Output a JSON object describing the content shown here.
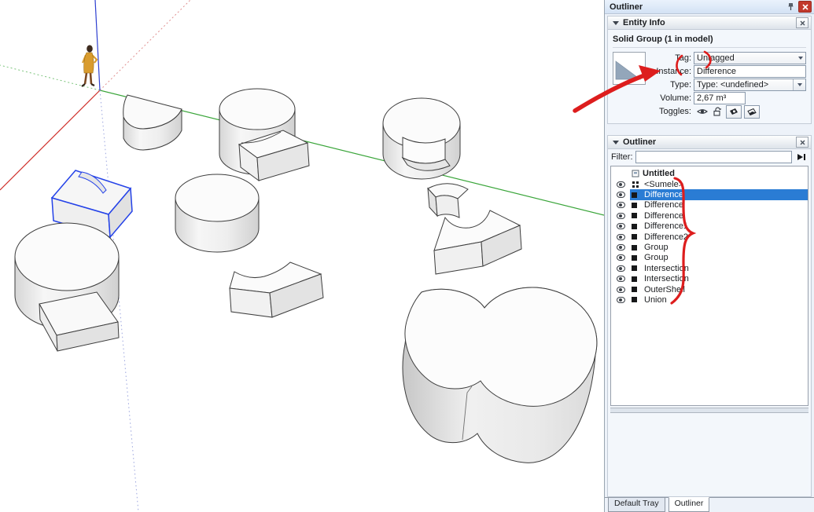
{
  "window": {
    "title": "Outliner"
  },
  "entity_info": {
    "header": "Entity Info",
    "summary": "Solid Group (1 in model)",
    "tag_label": "Tag:",
    "tag_value": "Untagged",
    "instance_label": "Instance:",
    "instance_value": "Difference",
    "type_label": "Type:",
    "type_value": "Type: <undefined>",
    "volume_label": "Volume:",
    "volume_value": "2,67 m³",
    "toggles_label": "Toggles:"
  },
  "outliner": {
    "header": "Outliner",
    "filter_label": "Filter:",
    "filter_value": "",
    "root_label": "Untitled",
    "items": [
      {
        "label": "<Sumele>",
        "icon": "component",
        "selected": false
      },
      {
        "label": "Difference",
        "icon": "group",
        "selected": true
      },
      {
        "label": "Difference",
        "icon": "group",
        "selected": false
      },
      {
        "label": "Difference",
        "icon": "group",
        "selected": false
      },
      {
        "label": "Difference1",
        "icon": "group",
        "selected": false
      },
      {
        "label": "Difference2",
        "icon": "group",
        "selected": false
      },
      {
        "label": "Group",
        "icon": "group",
        "selected": false
      },
      {
        "label": "Group",
        "icon": "group",
        "selected": false
      },
      {
        "label": "Intersection",
        "icon": "group",
        "selected": false
      },
      {
        "label": "Intersection",
        "icon": "group",
        "selected": false
      },
      {
        "label": "OuterShell",
        "icon": "group",
        "selected": false
      },
      {
        "label": "Union",
        "icon": "group",
        "selected": false
      }
    ]
  },
  "tray_tabs": {
    "default_tray": "Default Tray",
    "outliner": "Outliner"
  },
  "colors": {
    "selection_highlight": "#2a7cd4",
    "annotation_red": "#dd1d1d",
    "sketchup_selection_blue": "#2442e8",
    "axis_red": "#cf2d28",
    "axis_green": "#3aa53a",
    "axis_blue": "#2d3fd0",
    "panel_background": "#edf2f9"
  },
  "icons": [
    "pin-icon",
    "close-icon",
    "collapse-arrow-icon",
    "dropdown-chevron-icon",
    "eye-icon",
    "unlock-icon",
    "receive-shadows-icon",
    "cast-shadows-icon",
    "filter-go-icon",
    "model-icon",
    "component-icon",
    "group-icon"
  ]
}
